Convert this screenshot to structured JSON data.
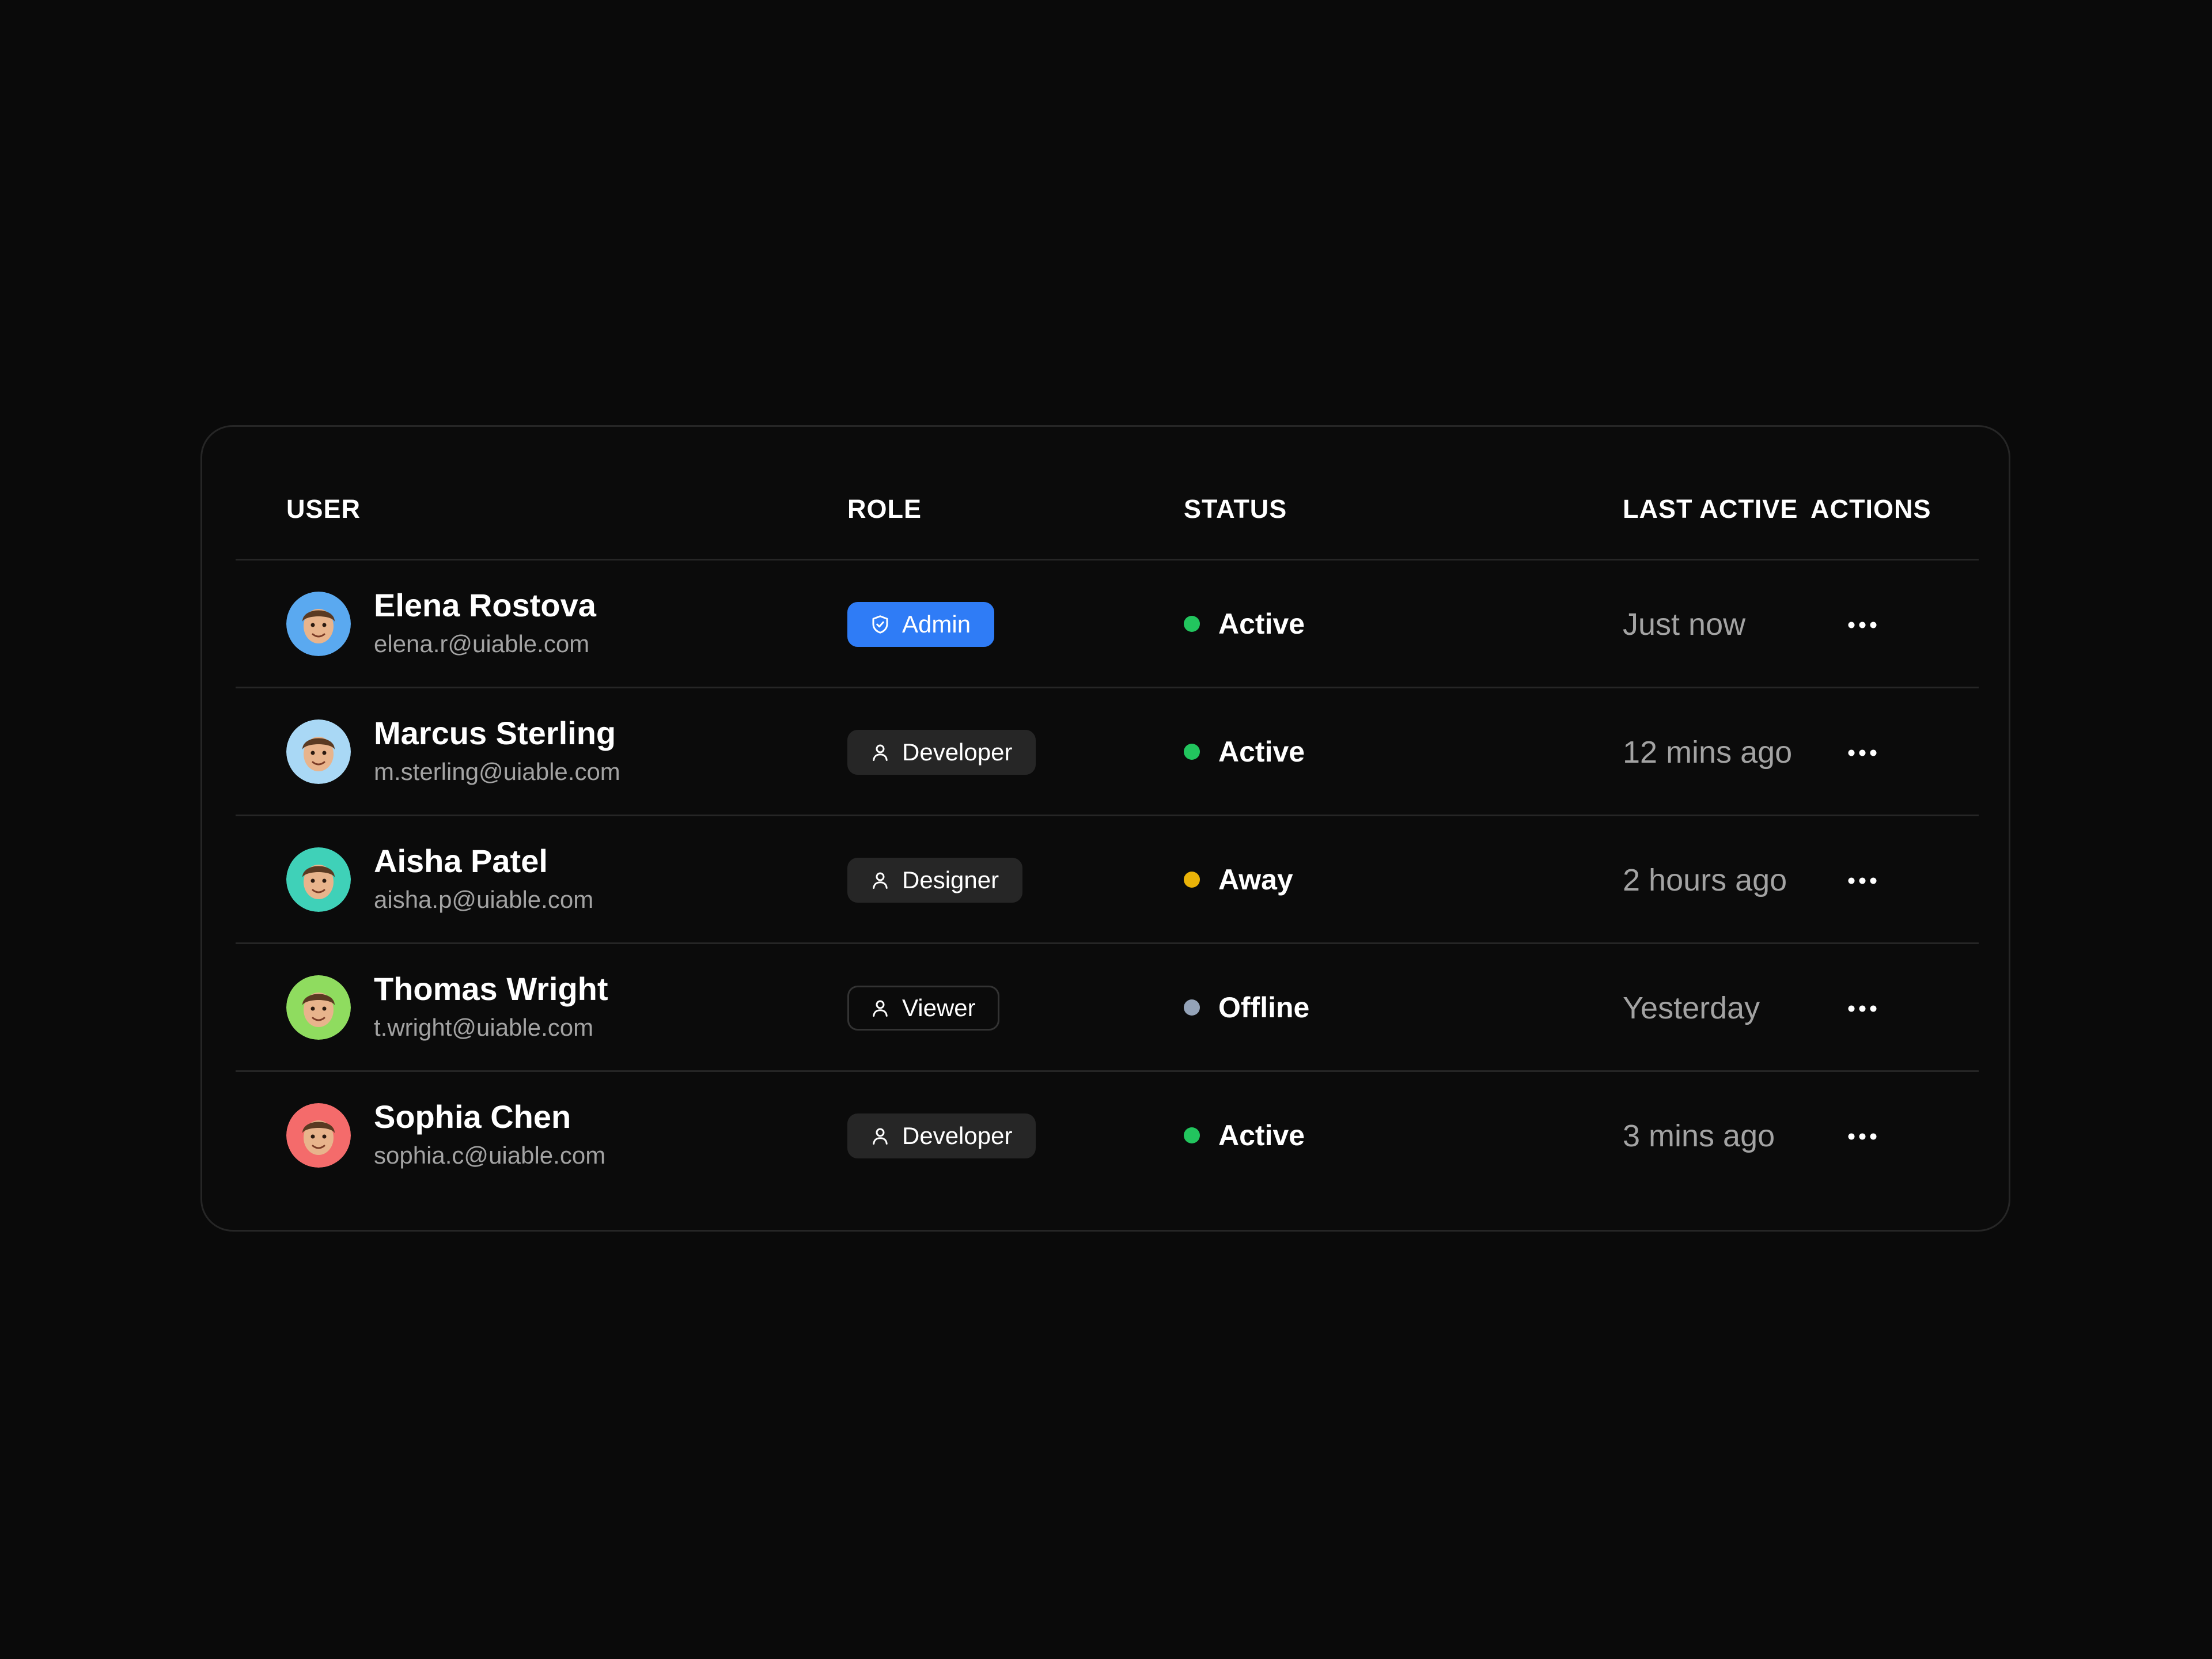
{
  "table": {
    "headers": {
      "user": "USER",
      "role": "ROLE",
      "status": "STATUS",
      "last_active": "LAST ACTIVE",
      "actions": "ACTIONS"
    },
    "rows": [
      {
        "name": "Elena Rostova",
        "email": "elena.r@uiable.com",
        "avatar_bg": "#5aa9f0",
        "role": "Admin",
        "role_icon": "shield-check-icon",
        "role_style": "admin",
        "status": "Active",
        "status_color": "#22c55e",
        "last_active": "Just now",
        "actions_icon": "more-horizontal-icon"
      },
      {
        "name": "Marcus Sterling",
        "email": "m.sterling@uiable.com",
        "avatar_bg": "#a9d8f5",
        "role": "Developer",
        "role_icon": "user-icon",
        "role_style": "default",
        "status": "Active",
        "status_color": "#22c55e",
        "last_active": "12 mins ago",
        "actions_icon": "more-horizontal-icon"
      },
      {
        "name": "Aisha Patel",
        "email": "aisha.p@uiable.com",
        "avatar_bg": "#3fd1b8",
        "role": "Designer",
        "role_icon": "user-icon",
        "role_style": "default",
        "status": "Away",
        "status_color": "#eab308",
        "last_active": "2 hours ago",
        "actions_icon": "more-horizontal-icon"
      },
      {
        "name": "Thomas Wright",
        "email": "t.wright@uiable.com",
        "avatar_bg": "#8fdc5f",
        "role": "Viewer",
        "role_icon": "user-icon",
        "role_style": "viewer",
        "status": "Offline",
        "status_color": "#94a3b8",
        "last_active": "Yesterday",
        "actions_icon": "more-horizontal-icon"
      },
      {
        "name": "Sophia Chen",
        "email": "sophia.c@uiable.com",
        "avatar_bg": "#f46b6b",
        "role": "Developer",
        "role_icon": "user-icon",
        "role_style": "default",
        "status": "Active",
        "status_color": "#22c55e",
        "last_active": "3 mins ago",
        "actions_icon": "more-horizontal-icon"
      }
    ]
  }
}
